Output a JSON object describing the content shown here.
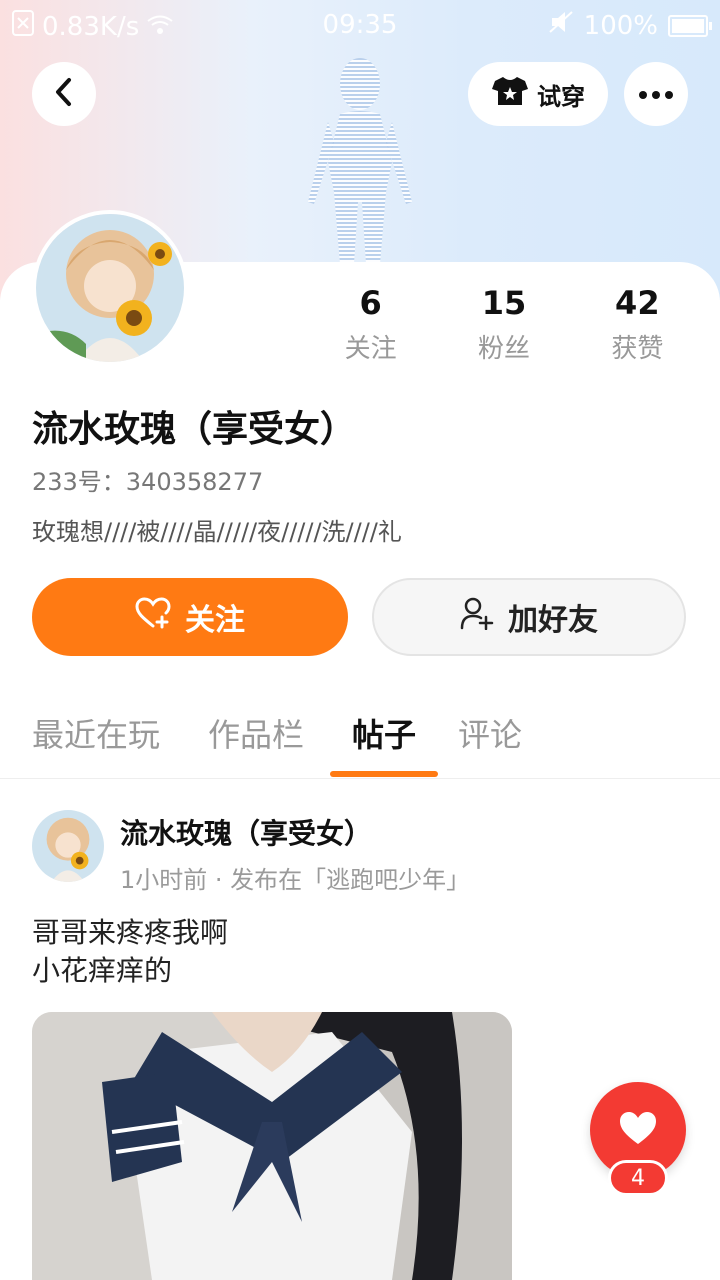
{
  "status_bar": {
    "network_speed": "0.83K/s",
    "time": "09:35",
    "battery": "100%"
  },
  "header": {
    "try_on_label": "试穿"
  },
  "profile": {
    "stats": [
      {
        "value": "6",
        "label": "关注"
      },
      {
        "value": "15",
        "label": "粉丝"
      },
      {
        "value": "42",
        "label": "获赞"
      }
    ],
    "name": "流水玫瑰（享受女）",
    "uid": "233号：340358277",
    "bio": "玫瑰想////被////晶/////夜/////洗////礼",
    "follow_label": "关注",
    "add_friend_label": "加好友"
  },
  "tabs": [
    {
      "label": "最近在玩"
    },
    {
      "label": "作品栏"
    },
    {
      "label": "帖子"
    },
    {
      "label": "评论"
    }
  ],
  "post": {
    "author": "流水玫瑰（享受女）",
    "meta": "1小时前 · 发布在「逃跑吧少年」",
    "text_line1": "哥哥来疼疼我啊",
    "text_line2": "小花痒痒的",
    "like_count": "4"
  },
  "colors": {
    "accent": "#ff7a13",
    "like": "#f33a33"
  }
}
